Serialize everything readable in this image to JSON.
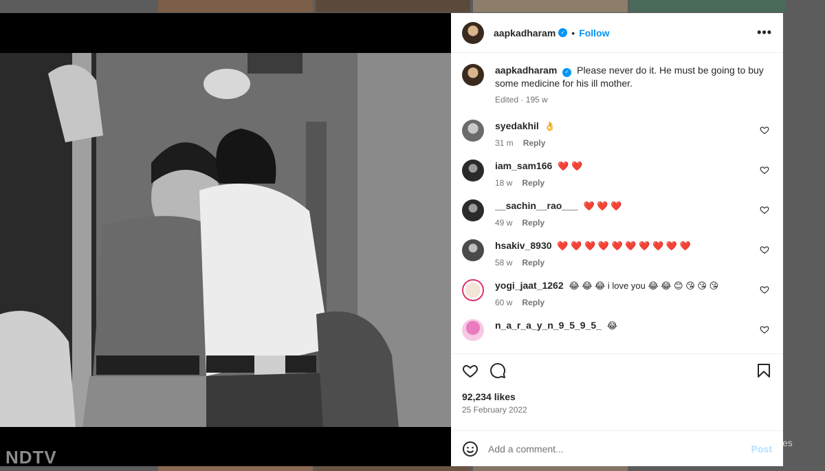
{
  "post": {
    "author": "aapkadharam",
    "follow_label": "Follow",
    "more_label": "•••",
    "caption": {
      "username": "aapkadharam",
      "text": "Please never do it. He must be going to buy some medicine for his ill mother.",
      "meta": "Edited · 195 w"
    },
    "comments": [
      {
        "username": "syedakhil",
        "text": "👌",
        "age": "31 m",
        "reply": "Reply"
      },
      {
        "username": "iam_sam166",
        "text": "❤️ ❤️",
        "age": "18 w",
        "reply": "Reply"
      },
      {
        "username": "__sachin__rao___",
        "text": "❤️ ❤️ ❤️",
        "age": "49 w",
        "reply": "Reply"
      },
      {
        "username": "hsakiv_8930",
        "text": "❤️ ❤️ ❤️ ❤️ ❤️ ❤️ ❤️ ❤️ ❤️ ❤️",
        "age": "58 w",
        "reply": "Reply"
      },
      {
        "username": "yogi_jaat_1262",
        "text": "😂 😂 😂  i love you 😂 😂 😊 😘 😘 😘",
        "age": "60 w",
        "reply": "Reply"
      },
      {
        "username": "n_a_r_a_y_n_9_5_9_5_",
        "text": "😂",
        "age": "",
        "reply": ""
      }
    ],
    "likes": "92,234 likes",
    "date": "25 February 2022",
    "add_comment_placeholder": "Add a comment...",
    "post_label": "Post"
  },
  "background": {
    "watermark": "NDTV",
    "right_text": "es"
  },
  "colors": {
    "accent": "#0095f6",
    "heart": "#f0255c"
  }
}
